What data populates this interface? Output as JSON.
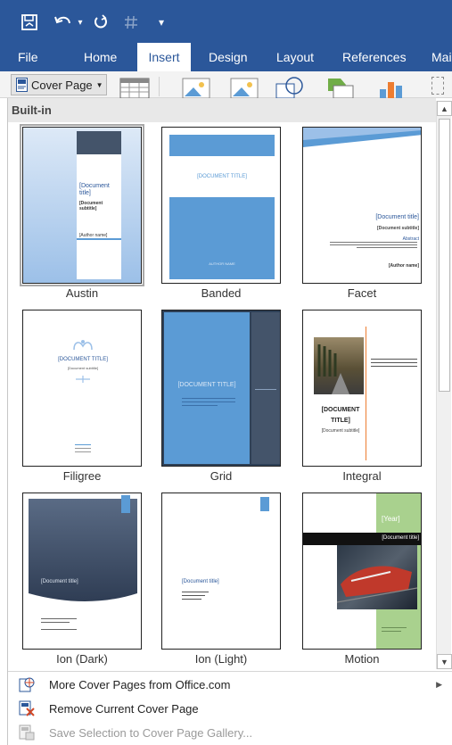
{
  "window": {
    "quick_access_customize": "▾"
  },
  "ribbon_tabs": [
    {
      "label": "File"
    },
    {
      "label": "Home"
    },
    {
      "label": "Insert"
    },
    {
      "label": "Design"
    },
    {
      "label": "Layout"
    },
    {
      "label": "References"
    },
    {
      "label": "Mai"
    }
  ],
  "ribbon": {
    "cover_page_label": "Cover Page"
  },
  "gallery": {
    "section_title": "Built-in",
    "tiles": [
      {
        "label": "Austin",
        "title": "[Document title]",
        "subtitle": "[Document subtitle]",
        "author": "[Author name]"
      },
      {
        "label": "Banded",
        "title": "[DOCUMENT TITLE]",
        "author": "AUTHOR NAME"
      },
      {
        "label": "Facet",
        "title": "[Document title]",
        "subtitle": "[Document subtitle]",
        "abstract_heading": "Abstract",
        "author": "[Author name]"
      },
      {
        "label": "Filigree",
        "title": "[DOCUMENT TITLE]",
        "subtitle": "[Document subtitle]"
      },
      {
        "label": "Grid",
        "title": "[DOCUMENT TITLE]"
      },
      {
        "label": "Integral",
        "title": "[DOCUMENT TITLE]",
        "subtitle": "[Document subtitle]"
      },
      {
        "label": "Ion (Dark)",
        "title": "[Document title]"
      },
      {
        "label": "Ion (Light)",
        "title": "[Document title]"
      },
      {
        "label": "Motion",
        "year": "[Year]",
        "title": "[Document title]"
      }
    ]
  },
  "menu": {
    "more_cover_pages": "More Cover Pages from Office.com",
    "remove_cover_page": "Remove Current Cover Page",
    "save_selection": "Save Selection to Cover Page Gallery..."
  },
  "colors": {
    "word_blue": "#2b579a",
    "tile_blue": "#5b9bd5",
    "slate": "#44546a",
    "motion_green": "#a9d18e"
  }
}
